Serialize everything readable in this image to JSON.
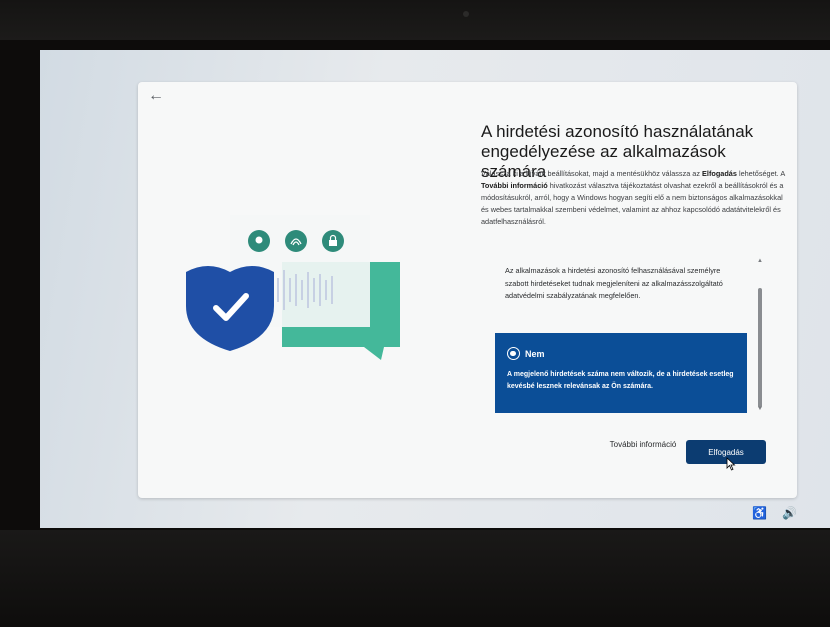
{
  "oobe": {
    "back_arrow": "←",
    "title": "A hirdetési azonosító használatának engedélyezése az alkalmazások számára",
    "description": {
      "part1": "Válassza ki a kívánt beállításokat, majd a mentésükhöz válassza az ",
      "accept_bold": "Elfogadás",
      "part2": " lehetőséget. A ",
      "more_info_bold": "További információ",
      "part3": " hivatkozást választva tájékoztatást olvashat ezekről a beállításokról és a módosításukról, arról, hogy a Windows hogyan segíti elő a nem biztonságos alkalmazásokkal és webes tartalmakkal szembeni védelmet, valamint az ahhoz kapcsolódó adatátvitelekről és adatfelhasználásról."
    },
    "options": {
      "yes_body": "Az alkalmazások a hirdetési azonosító felhasználásával személyre szabott hirdetéseket tudnak megjeleníteni az alkalmazásszolgáltató adatvédelmi szabályzatának megfelelően.",
      "no_title": "Nem",
      "no_body": "A megjelenő hirdetések száma nem változik, de a hirdetések esetleg kevésbé lesznek relevánsak az Ön számára."
    },
    "buttons": {
      "more_info": "További információ",
      "accept": "Elfogadás"
    }
  },
  "taskbar": {
    "accessibility_icon": "accessibility-icon",
    "volume_icon": "volume-icon"
  },
  "colors": {
    "selected_option": "#0b4e97",
    "accept_button": "#0c3c71",
    "shield": "#1f4fa6",
    "chat_bubble": "#44b89a"
  }
}
